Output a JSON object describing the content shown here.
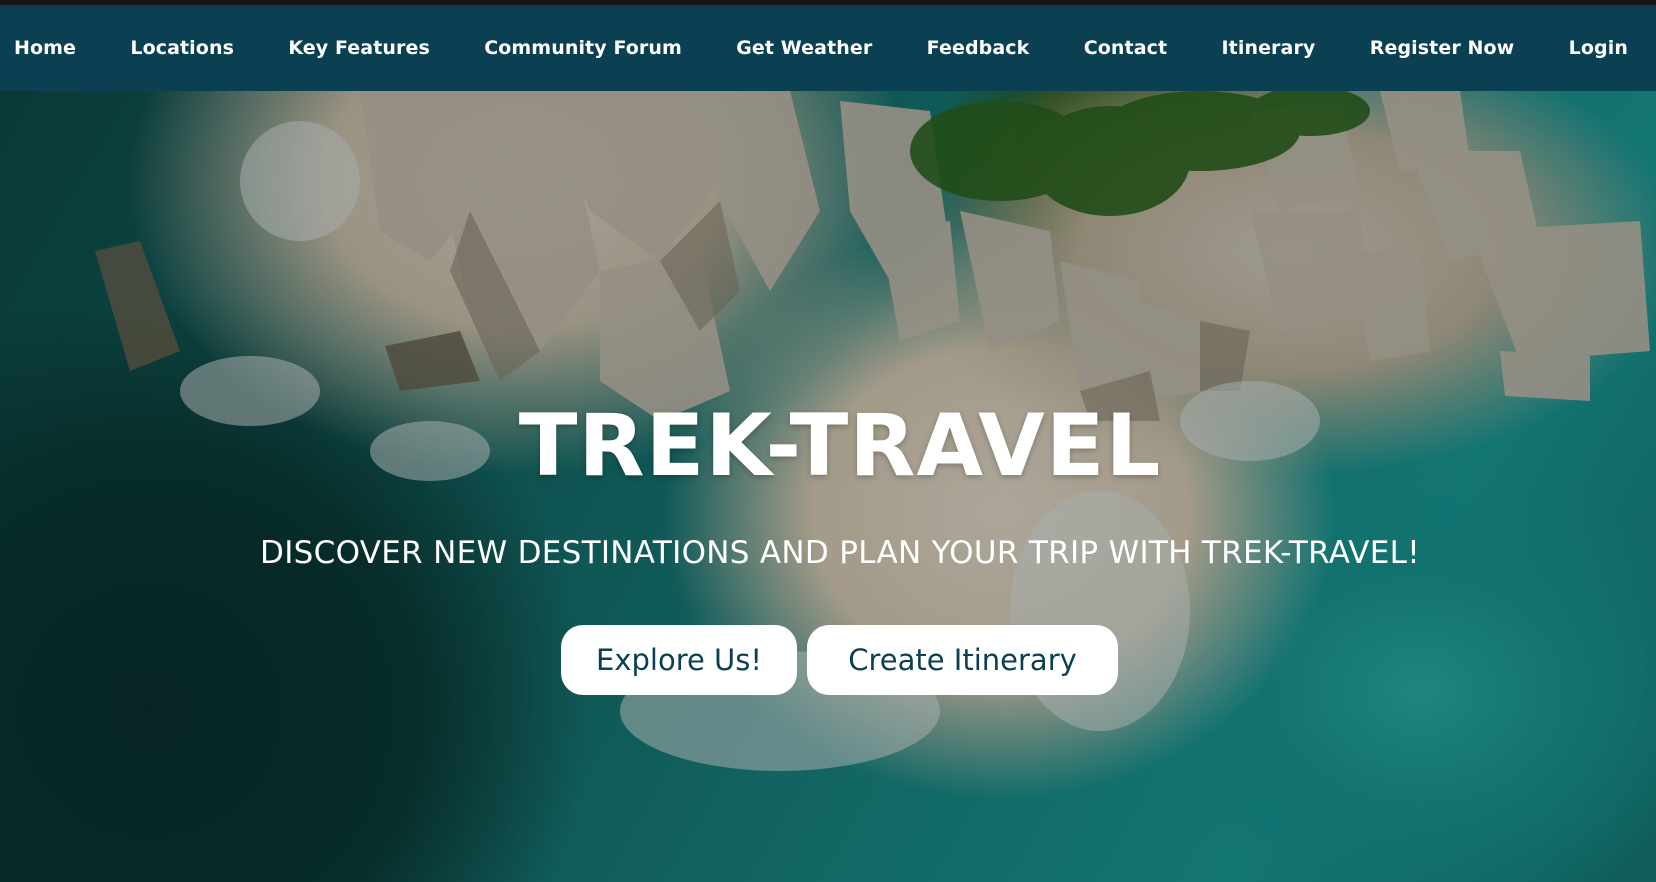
{
  "nav": {
    "items": [
      {
        "label": "Home"
      },
      {
        "label": "Locations"
      },
      {
        "label": "Key Features"
      },
      {
        "label": "Community Forum"
      },
      {
        "label": "Get Weather"
      },
      {
        "label": "Feedback"
      },
      {
        "label": "Contact"
      },
      {
        "label": "Itinerary"
      },
      {
        "label": "Register Now"
      },
      {
        "label": "Login"
      }
    ]
  },
  "hero": {
    "title": "TREK-TRAVEL",
    "subtitle": "DISCOVER NEW DESTINATIONS AND PLAN YOUR TRIP WITH TREK-TRAVEL!",
    "buttons": {
      "explore": "Explore Us!",
      "create": "Create Itinerary"
    }
  },
  "colors": {
    "navbar": "#0b3f52",
    "button_bg": "#ffffff",
    "button_text": "#0b3f52"
  }
}
